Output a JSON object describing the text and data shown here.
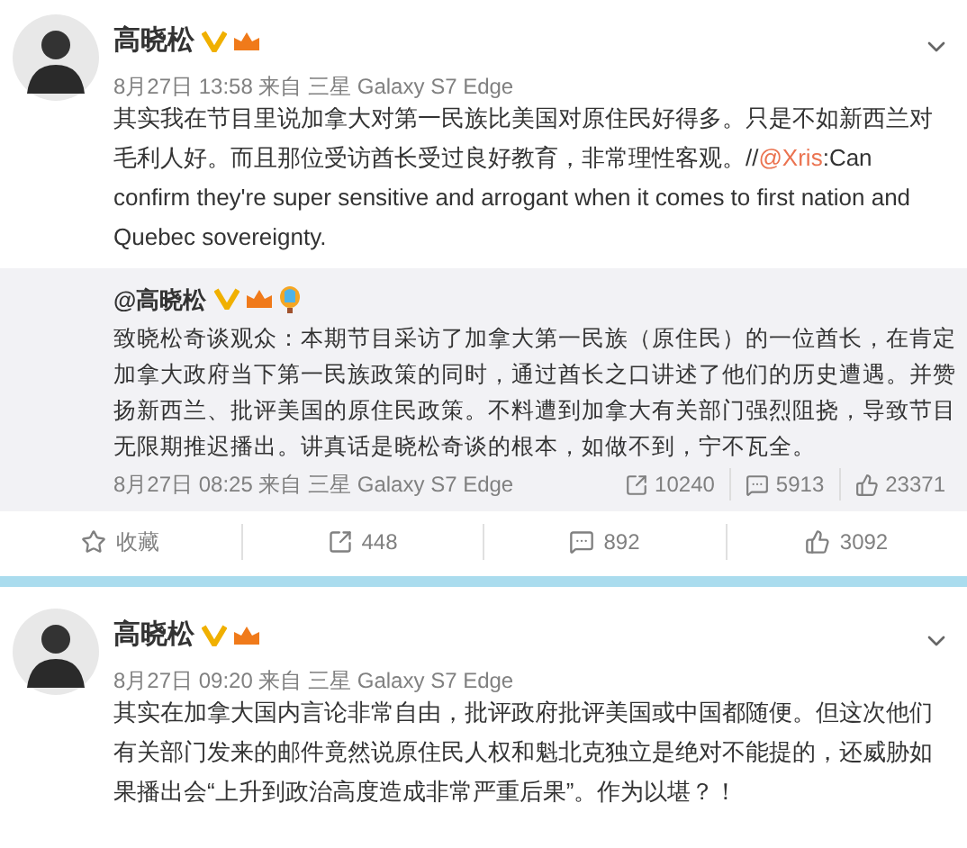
{
  "post": {
    "author": "高晓松",
    "meta": "8月27日 13:58 来自 三星 Galaxy S7 Edge",
    "text_parts": [
      {
        "kind": "plain",
        "text": "其实我在节目里说加拿大对第一民族比美国对原住民好得多。只是不如新西兰对毛利人好。而且那位受访酋长受过良好教育，非常理性客观。//"
      },
      {
        "kind": "mention",
        "text": "@Xris"
      },
      {
        "kind": "plain",
        "text": ":Can confirm they're super sensitive and arrogant when it comes to first nation and Quebec sovereignty."
      }
    ],
    "repost": {
      "author": "@高晓松",
      "text": "致晓松奇谈观众：本期节目采访了加拿大第一民族（原住民）的一位酋长，在肯定加拿大政府当下第一民族政策的同时，通过酋长之口讲述了他们的历史遭遇。并赞扬新西兰、批评美国的原住民政策。不料遭到加拿大有关部门强烈阻挠，导致节目无限期推迟播出。讲真话是晓松奇谈的根本，如做不到，宁不瓦全。",
      "meta": "8月27日 08:25 来自 三星 Galaxy S7 Edge",
      "stats": [
        {
          "kind": "share",
          "text": "10240"
        },
        {
          "kind": "comment",
          "text": "5913"
        },
        {
          "kind": "like",
          "text": "23371"
        }
      ]
    },
    "actions": [
      {
        "kind": "favorite",
        "text": "收藏"
      },
      {
        "kind": "share",
        "text": "448"
      },
      {
        "kind": "comment",
        "text": "892"
      },
      {
        "kind": "like",
        "text": "3092"
      }
    ]
  },
  "post2": {
    "author": "高晓松",
    "meta": "8月27日 09:20 来自 三星 Galaxy S7 Edge",
    "text": "其实在加拿大国内言论非常自由，批评政府批评美国或中国都随便。但这次他们有关部门发来的邮件竟然说原住民人权和魁北克独立是绝对不能提的，还威胁如果播出会“上升到政治高度造成非常严重后果”。作为以堪？！"
  }
}
